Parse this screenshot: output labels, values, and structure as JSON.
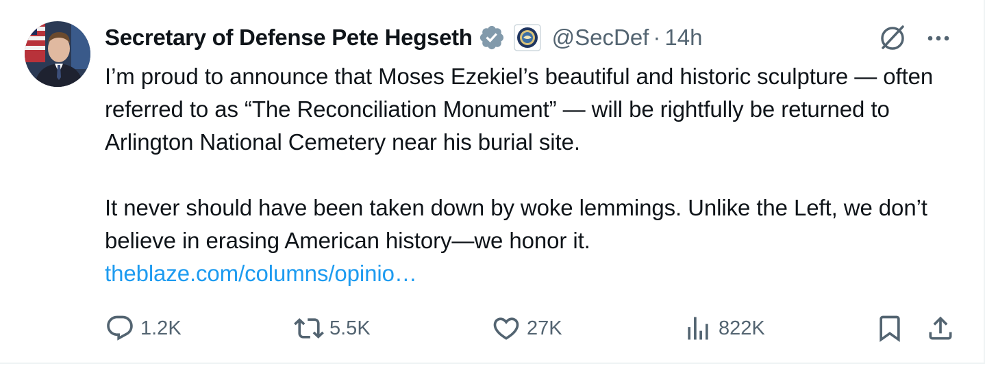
{
  "author": {
    "display_name": "Secretary of Defense Pete Hegseth",
    "handle": "@SecDef",
    "separator": "·",
    "time": "14h",
    "verified_color": "#829aab",
    "avatar_icon": "profile-photo"
  },
  "tweet": {
    "paragraphs": [
      "I’m proud to announce that Moses Ezekiel’s beautiful and historic sculpture — often referred to as “The Reconciliation Monument” — will be rightfully be returned to Arlington National Cemetery near his burial site.",
      "It never should have been taken down by woke lemmings. Unlike the Left, we don’t believe in erasing American history—we honor it."
    ],
    "link_text": "theblaze.com/columns/opinio…",
    "link_color": "#1d9bf0"
  },
  "actions": {
    "replies": "1.2K",
    "reposts": "5.5K",
    "likes": "27K",
    "views": "822K"
  },
  "colors": {
    "text": "#0f1419",
    "secondary": "#536471",
    "border": "#eff3f4"
  }
}
